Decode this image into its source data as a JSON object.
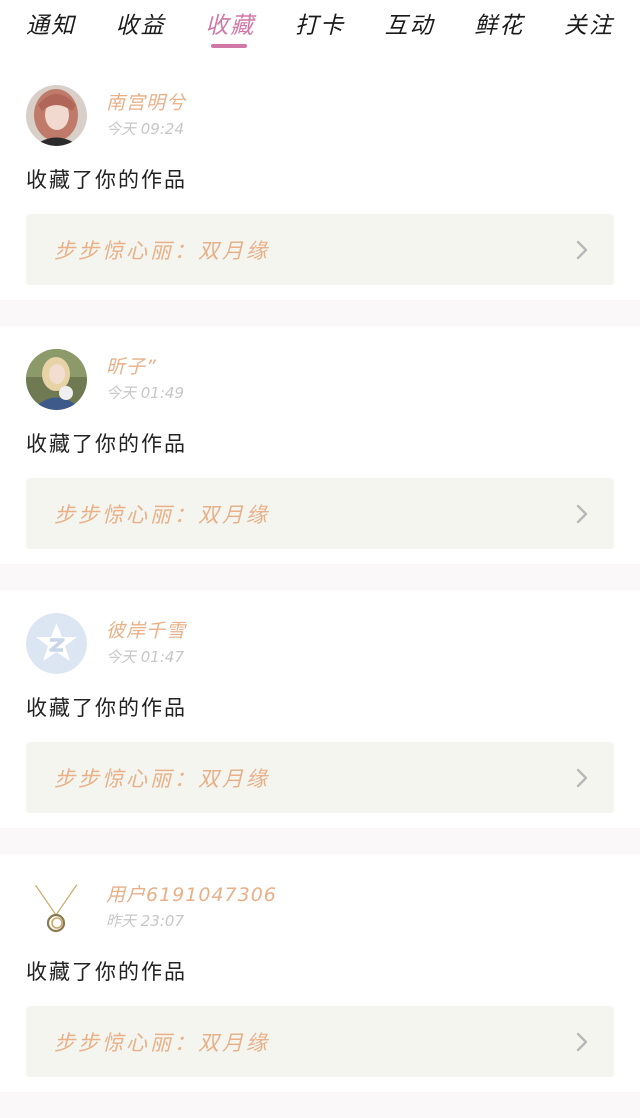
{
  "tabs": [
    {
      "label": "通知"
    },
    {
      "label": "收益"
    },
    {
      "label": "收藏",
      "active": true
    },
    {
      "label": "打卡"
    },
    {
      "label": "互动"
    },
    {
      "label": "鲜花"
    },
    {
      "label": "关注"
    }
  ],
  "items": [
    {
      "user": "南宫明兮",
      "time": "今天 09:24",
      "action": "收藏了你的作品",
      "work": "步步惊心丽：双月缘"
    },
    {
      "user": "昕子”",
      "time": "今天 01:49",
      "action": "收藏了你的作品",
      "work": "步步惊心丽：双月缘"
    },
    {
      "user": "彼岸千雪",
      "time": "今天 01:47",
      "action": "收藏了你的作品",
      "work": "步步惊心丽：双月缘"
    },
    {
      "user": "用户6191047306",
      "time": "昨天 23:07",
      "action": "收藏了你的作品",
      "work": "步步惊心丽：双月缘"
    }
  ],
  "colors": {
    "accent": "#d278a6",
    "name": "#e8b089",
    "work_bg": "#f5f5ef"
  }
}
